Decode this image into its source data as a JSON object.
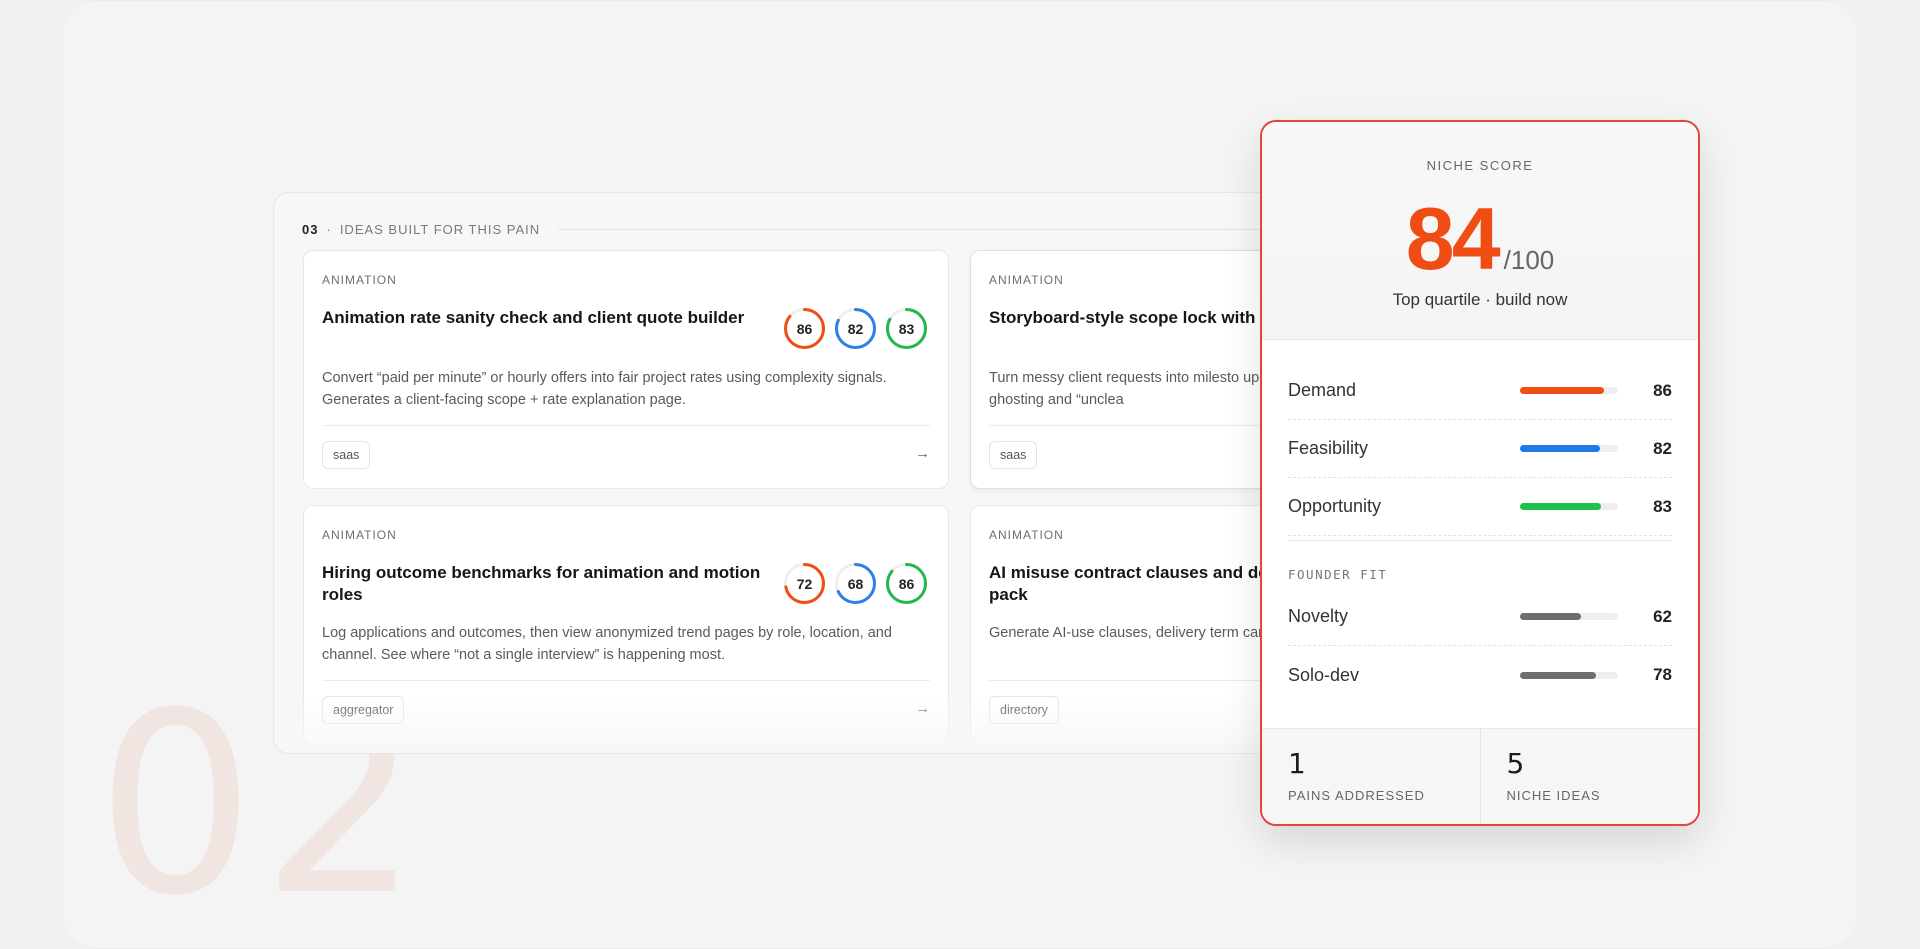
{
  "watermark": "02",
  "panel": {
    "section_number": "03",
    "separator": "·",
    "section_title": "IDEAS BUILT FOR THIS PAIN",
    "cards": [
      {
        "category": "ANIMATION",
        "title": "Animation rate sanity check and client quote builder",
        "description": "Convert “paid per minute” or hourly offers into fair project rates using complexity signals. Generates a client-facing scope + rate explanation page.",
        "tag": "saas",
        "scores": [
          {
            "value": 86,
            "fraction": 0.86,
            "color": "#f04d14"
          },
          {
            "value": 82,
            "fraction": 0.82,
            "color": "#2f7fe6"
          },
          {
            "value": 83,
            "fraction": 0.83,
            "color": "#22b84a"
          }
        ]
      },
      {
        "category": "ANIMATION",
        "title": "Storyboard-style scope lock with",
        "description": "Turn messy client requests into milesto updates. Reduce ghosting and “unclea",
        "tag": "saas",
        "scores": []
      },
      {
        "category": "ANIMATION",
        "title": "Hiring outcome benchmarks for animation and motion roles",
        "description": "Log applications and outcomes, then view anonymized trend pages by role, location, and channel. See where “not a single interview” is happening most.",
        "tag": "aggregator",
        "scores": [
          {
            "value": 72,
            "fraction": 0.72,
            "color": "#f04d14"
          },
          {
            "value": 68,
            "fraction": 0.68,
            "color": "#2f7fe6"
          },
          {
            "value": 86,
            "fraction": 0.86,
            "color": "#22b84a"
          }
        ]
      },
      {
        "category": "ANIMATION",
        "title": "AI misuse contract clauses and de pack",
        "description": "Generate AI-use clauses, delivery term can’t claim permission to make an “AI v",
        "tag": "directory",
        "scores": []
      }
    ],
    "arrow_icon": "arrow-right-icon"
  },
  "score_card": {
    "label": "NICHE SCORE",
    "value": "84",
    "max": "/100",
    "subtitle": "Top quartile · build now",
    "metrics": [
      {
        "name": "Demand",
        "value": "86",
        "fraction": 0.86,
        "color": "#f04d14"
      },
      {
        "name": "Feasibility",
        "value": "82",
        "fraction": 0.82,
        "color": "#1f7ae8"
      },
      {
        "name": "Opportunity",
        "value": "83",
        "fraction": 0.83,
        "color": "#1ec24b"
      }
    ],
    "founder_fit_label": "FOUNDER FIT",
    "founder_fit": [
      {
        "name": "Novelty",
        "value": "62",
        "fraction": 0.62,
        "color": "#6e6e72"
      },
      {
        "name": "Solo-dev",
        "value": "78",
        "fraction": 0.78,
        "color": "#6e6e72"
      }
    ],
    "stats": [
      {
        "value": "1",
        "label": "PAINS ADDRESSED"
      },
      {
        "value": "5",
        "label": "NICHE IDEAS"
      }
    ]
  }
}
